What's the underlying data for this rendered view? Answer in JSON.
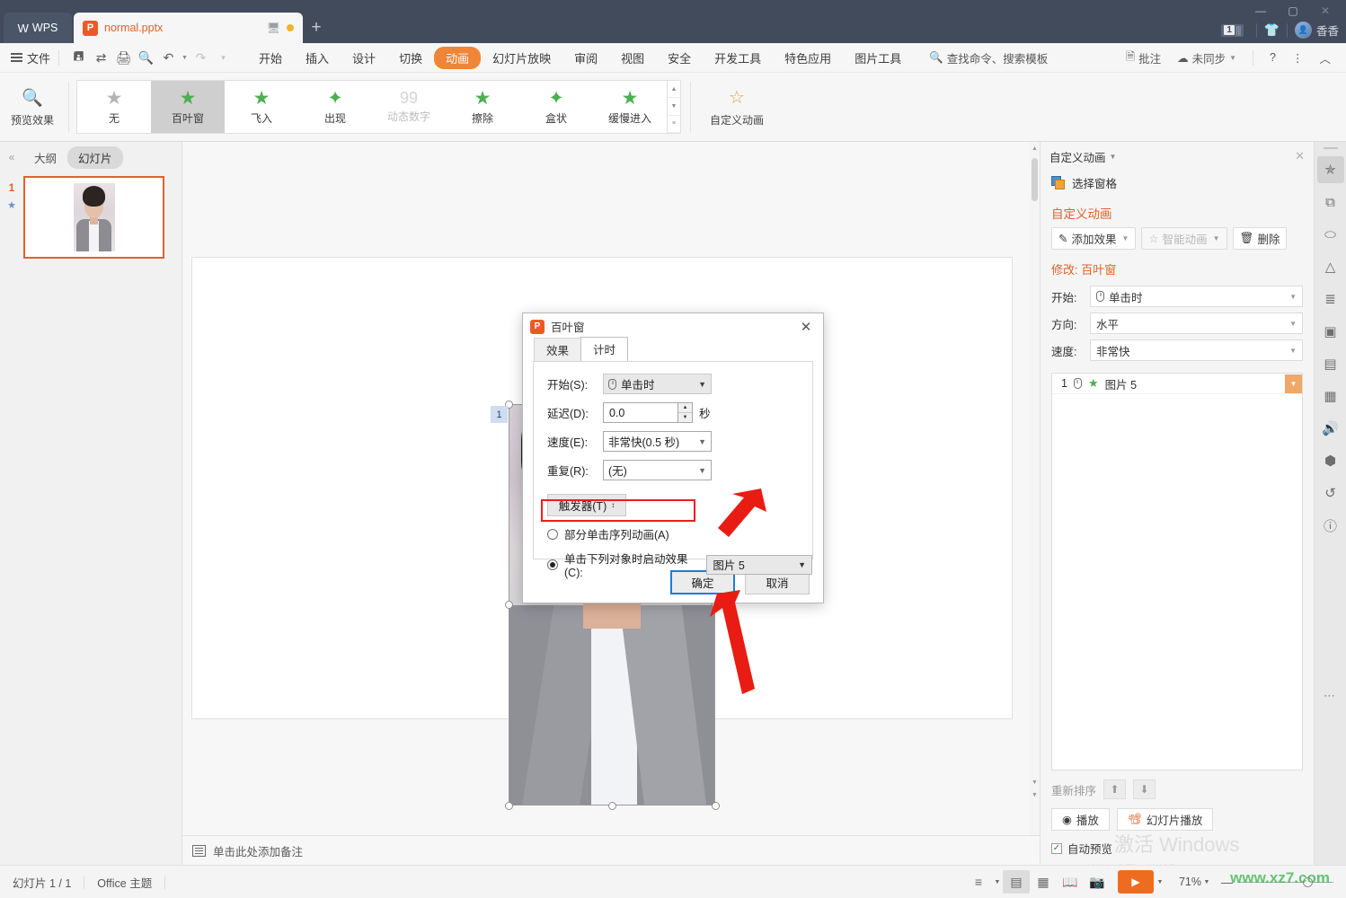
{
  "titlebar": {
    "wps_label": "WPS",
    "file_tab": "normal.pptx",
    "new_tab": "+",
    "presenter_icon": "monitor-icon",
    "minimize": "—",
    "maximize": "▢",
    "close": "✕",
    "count_badge": "1",
    "user_name": "香香"
  },
  "menubar": {
    "file": "文件",
    "quick": [
      "save-icon",
      "cloud-share-icon",
      "print-icon",
      "print-preview-icon",
      "undo-icon",
      "redo-icon",
      "more-icon"
    ],
    "items": [
      "开始",
      "插入",
      "设计",
      "切换",
      "动画",
      "幻灯片放映",
      "审阅",
      "视图",
      "安全",
      "开发工具",
      "特色应用",
      "图片工具"
    ],
    "active_item": "动画",
    "search_placeholder": "查找命令、搜索模板",
    "right": {
      "comment": "批注",
      "sync": "未同步",
      "help": "?",
      "more": "⋮",
      "collapse": "︿"
    }
  },
  "ribbon": {
    "preview_label": "预览效果",
    "gallery": [
      {
        "label": "无",
        "state": "normal",
        "icon": "star-grey"
      },
      {
        "label": "百叶窗",
        "state": "selected",
        "icon": "star-blinds"
      },
      {
        "label": "飞入",
        "state": "normal",
        "icon": "star-flyin"
      },
      {
        "label": "出现",
        "state": "normal",
        "icon": "star-appear"
      },
      {
        "label": "动态数字",
        "state": "disabled",
        "icon": "number-99"
      },
      {
        "label": "擦除",
        "state": "normal",
        "icon": "star-wipe"
      },
      {
        "label": "盒状",
        "state": "normal",
        "icon": "star-box"
      },
      {
        "label": "缓慢进入",
        "state": "normal",
        "icon": "star-slow"
      }
    ],
    "custom_animation": "自定义动画"
  },
  "leftpanel": {
    "collapse": "«",
    "tabs": [
      "大纲",
      "幻灯片"
    ],
    "active_tab": "幻灯片",
    "slide_number": "1",
    "slide_star": "★"
  },
  "editor": {
    "animation_tag": "1",
    "minus_badge": "−",
    "notes_placeholder": "单击此处添加备注"
  },
  "dialog": {
    "title": "百叶窗",
    "close": "✕",
    "tabs": [
      "效果",
      "计时"
    ],
    "active_tab": "计时",
    "fields": [
      {
        "label": "开始(S):",
        "value": "单击时",
        "type": "dropdown-grey"
      },
      {
        "label": "延迟(D):",
        "value": "0.0",
        "unit": "秒",
        "type": "spinner"
      },
      {
        "label": "速度(E):",
        "value": "非常快(0.5 秒)",
        "type": "dropdown"
      },
      {
        "label": "重复(R):",
        "value": "(无)",
        "type": "dropdown"
      }
    ],
    "trigger_button": "触发器(T)",
    "radio_a": "部分单击序列动画(A)",
    "radio_c": "单击下列对象时启动效果(C):",
    "radio_selected": "c",
    "object_value": "图片 5",
    "ok": "确定",
    "cancel": "取消"
  },
  "rightpanel": {
    "title": "自定义动画",
    "close": "✕",
    "select_pane": "选择窗格",
    "section_title": "自定义动画",
    "add_effect": "添加效果",
    "smart_anim": "智能动画",
    "delete": "删除",
    "modify_label": "修改:",
    "modify_effect": "百叶窗",
    "fields": [
      {
        "label": "开始:",
        "value": "单击时"
      },
      {
        "label": "方向:",
        "value": "水平"
      },
      {
        "label": "速度:",
        "value": "非常快"
      }
    ],
    "list_items": [
      {
        "index": "1",
        "name": "图片 5",
        "trigger_icon": "mouse-icon",
        "effect_icon": "star-blinds-icon"
      }
    ],
    "reorder_label": "重新排序",
    "play": "播放",
    "slideshow": "幻灯片播放",
    "autopreview": "自动预览",
    "watermark_line1": "激活 Windows",
    "watermark_line2": "转到\"设置\"以激活 Windows。"
  },
  "rail": {
    "icons": [
      {
        "name": "animation-pane-icon",
        "glyph": "✩",
        "active": true
      },
      {
        "name": "shape-replace-icon",
        "glyph": "⧉",
        "active": false
      },
      {
        "name": "shape-icon",
        "glyph": "⬭",
        "active": false
      },
      {
        "name": "text-format-icon",
        "glyph": "A",
        "active": false
      },
      {
        "name": "adjust-settings-icon",
        "glyph": "⚟",
        "active": false
      },
      {
        "name": "image-group-icon",
        "glyph": "▤",
        "active": false
      },
      {
        "name": "box-icon",
        "glyph": "▭",
        "active": false
      },
      {
        "name": "picture-icon",
        "glyph": "▨",
        "active": false
      },
      {
        "name": "sound-icon",
        "glyph": "◁)",
        "active": false
      },
      {
        "name": "security-icon",
        "glyph": "⬡",
        "active": false
      },
      {
        "name": "history-icon",
        "glyph": "↺",
        "active": false
      },
      {
        "name": "help-icon",
        "glyph": "?",
        "active": false
      }
    ],
    "more_dots": "⋯"
  },
  "statusbar": {
    "slide_count": "幻灯片 1 / 1",
    "theme": "Office 主题",
    "view_icons": [
      "list-view-icon",
      "normal-view-icon",
      "slide-sorter-icon",
      "reading-view-icon",
      "presenter-icon"
    ],
    "active_view": "normal-view-icon",
    "play_button": "▶",
    "zoom_level": "71%",
    "zoom_minus": "—",
    "watermark": "www.xz7.com"
  }
}
